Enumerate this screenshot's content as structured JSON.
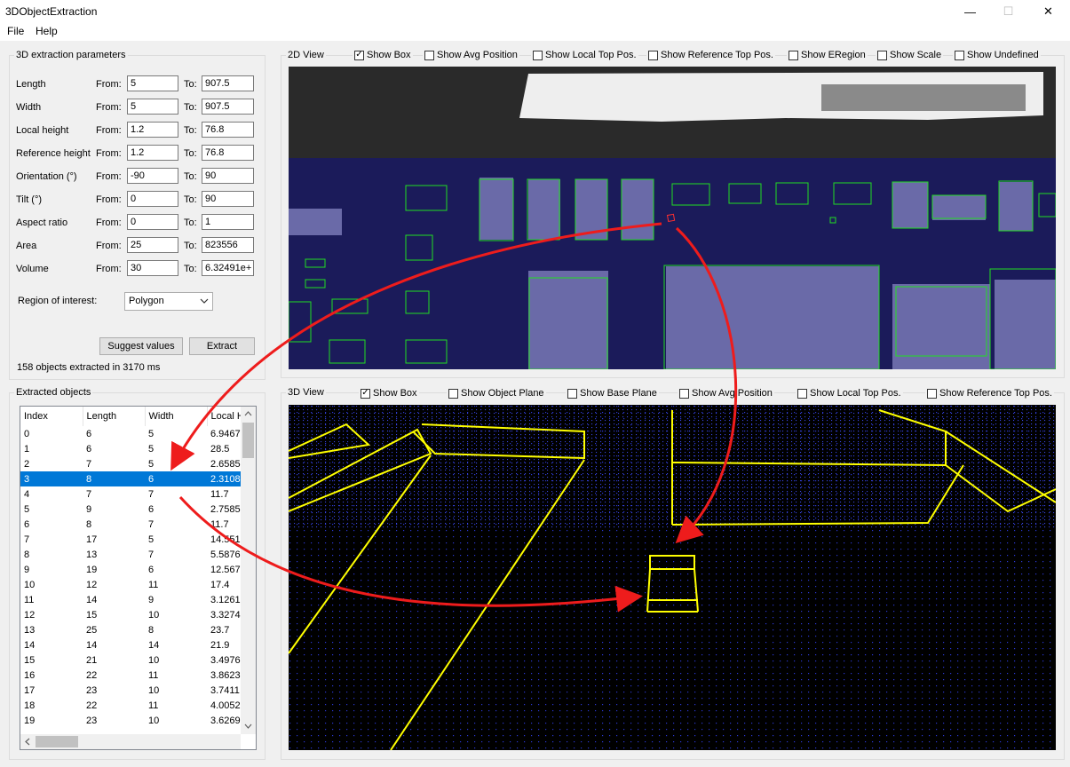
{
  "window": {
    "title": "3DObjectExtraction",
    "minimize": "—",
    "maximize": "☐",
    "close": "✕"
  },
  "menu": [
    "File",
    "Help"
  ],
  "params": {
    "title": "3D extraction parameters",
    "from_label": "From:",
    "to_label": "To:",
    "rows": [
      {
        "label": "Length",
        "from": "5",
        "to": "907.5"
      },
      {
        "label": "Width",
        "from": "5",
        "to": "907.5"
      },
      {
        "label": "Local height",
        "from": "1.2",
        "to": "76.8"
      },
      {
        "label": "Reference height",
        "from": "1.2",
        "to": "76.8"
      },
      {
        "label": "Orientation (°)",
        "from": "-90",
        "to": "90"
      },
      {
        "label": "Tilt (°)",
        "from": "0",
        "to": "90"
      },
      {
        "label": "Aspect ratio",
        "from": "0",
        "to": "1"
      },
      {
        "label": "Area",
        "from": "25",
        "to": "823556"
      },
      {
        "label": "Volume",
        "from": "30",
        "to": "6.32491e+"
      }
    ],
    "roi_label": "Region of interest:",
    "roi_value": "Polygon",
    "suggest_button": "Suggest values",
    "extract_button": "Extract",
    "status": "158 objects extracted in 3170 ms"
  },
  "objects": {
    "title": "Extracted objects",
    "columns": [
      "Index",
      "Length",
      "Width",
      "Local H"
    ],
    "selected_index": 3,
    "rows": [
      [
        "0",
        "6",
        "5",
        "6.9467"
      ],
      [
        "1",
        "6",
        "5",
        "28.5"
      ],
      [
        "2",
        "7",
        "5",
        "2.6585"
      ],
      [
        "3",
        "8",
        "6",
        "2.3108"
      ],
      [
        "4",
        "7",
        "7",
        "11.7"
      ],
      [
        "5",
        "9",
        "6",
        "2.7585"
      ],
      [
        "6",
        "8",
        "7",
        "11.7"
      ],
      [
        "7",
        "17",
        "5",
        "14.551"
      ],
      [
        "8",
        "13",
        "7",
        "5.5876"
      ],
      [
        "9",
        "19",
        "6",
        "12.567"
      ],
      [
        "10",
        "12",
        "11",
        "17.4"
      ],
      [
        "11",
        "14",
        "9",
        "3.1261"
      ],
      [
        "12",
        "15",
        "10",
        "3.3274"
      ],
      [
        "13",
        "25",
        "8",
        "23.7"
      ],
      [
        "14",
        "14",
        "14",
        "21.9"
      ],
      [
        "15",
        "21",
        "10",
        "3.4976"
      ],
      [
        "16",
        "22",
        "11",
        "3.8623"
      ],
      [
        "17",
        "23",
        "10",
        "3.7411"
      ],
      [
        "18",
        "22",
        "11",
        "4.0052"
      ],
      [
        "19",
        "23",
        "10",
        "3.6269"
      ]
    ]
  },
  "view2d": {
    "title": "2D View",
    "options": [
      {
        "label": "Show Box",
        "checked": true
      },
      {
        "label": "Show Avg Position",
        "checked": false
      },
      {
        "label": "Show Local Top Pos.",
        "checked": false
      },
      {
        "label": "Show Reference Top Pos.",
        "checked": false
      },
      {
        "label": "Show ERegion",
        "checked": false
      },
      {
        "label": "Show Scale",
        "checked": false
      },
      {
        "label": "Show Undefined",
        "checked": false
      }
    ]
  },
  "view3d": {
    "title": "3D View",
    "options": [
      {
        "label": "Show Box",
        "checked": true
      },
      {
        "label": "Show Object Plane",
        "checked": false
      },
      {
        "label": "Show Base Plane",
        "checked": false
      },
      {
        "label": "Show Avg Position",
        "checked": false
      },
      {
        "label": "Show Local Top Pos.",
        "checked": false
      },
      {
        "label": "Show Reference Top Pos.",
        "checked": false
      }
    ]
  },
  "colors": {
    "selection": "#0078d7",
    "box2d": "#22dd22",
    "box3d": "#ffff00",
    "arrow": "#ee1c1c",
    "pcb": "#1b1b5a",
    "points": "#2a36d0"
  }
}
